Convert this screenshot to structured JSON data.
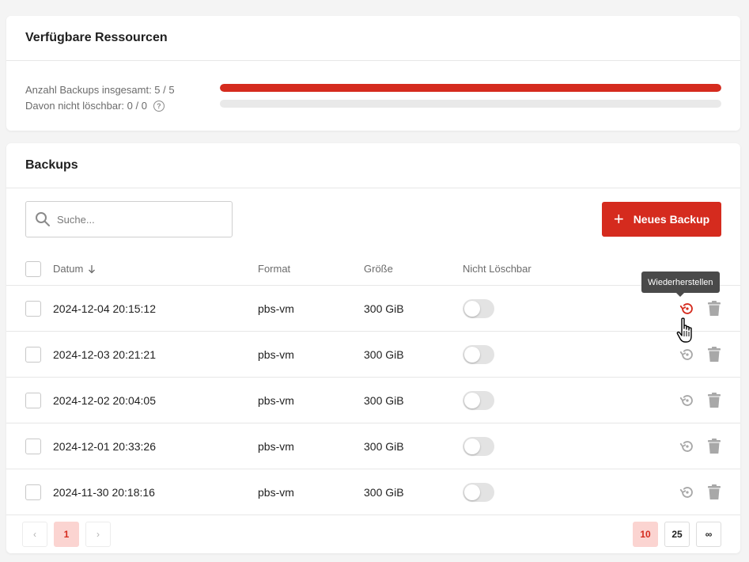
{
  "resources": {
    "title": "Verfügbare Ressourcen",
    "total_label": "Anzahl Backups insgesamt: 5 / 5",
    "total_fraction": 1.0,
    "undeletable_label": "Davon nicht löschbar: 0 / 0",
    "undeletable_fraction": 0.0,
    "help_icon": "question-circle-icon"
  },
  "backups": {
    "title": "Backups",
    "search": {
      "placeholder": "Suche...",
      "value": ""
    },
    "new_button": "Neues Backup",
    "columns": {
      "date": "Datum",
      "format": "Format",
      "size": "Größe",
      "not_deletable": "Nicht Löschbar"
    },
    "rows": [
      {
        "date": "2024-12-04 20:15:12",
        "format": "pbs-vm",
        "size": "300 GiB",
        "not_deletable": false
      },
      {
        "date": "2024-12-03 20:21:21",
        "format": "pbs-vm",
        "size": "300 GiB",
        "not_deletable": false
      },
      {
        "date": "2024-12-02 20:04:05",
        "format": "pbs-vm",
        "size": "300 GiB",
        "not_deletable": false
      },
      {
        "date": "2024-12-01 20:33:26",
        "format": "pbs-vm",
        "size": "300 GiB",
        "not_deletable": false
      },
      {
        "date": "2024-11-30 20:18:16",
        "format": "pbs-vm",
        "size": "300 GiB",
        "not_deletable": false
      }
    ],
    "tooltip": "Wiederherstellen",
    "pagination": {
      "prev": "‹",
      "next": "›",
      "current_page": "1",
      "page_sizes": [
        "10",
        "25",
        "∞"
      ],
      "selected_page_size": "10"
    }
  },
  "colors": {
    "accent": "#d52b1e",
    "accent_light": "#fbd4d1",
    "icon_gray": "#a8a8a8"
  }
}
